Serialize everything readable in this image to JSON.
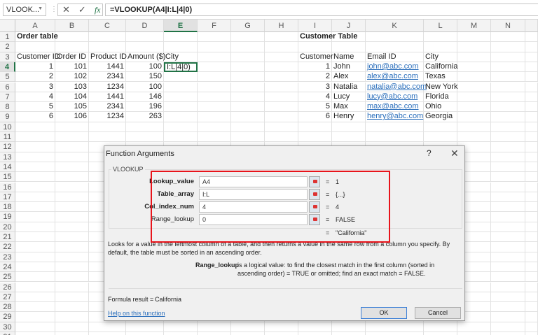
{
  "formula_bar": {
    "name_box": "VLOOK...",
    "formula": "=VLOOKUP(A4|I:L|4|0)"
  },
  "sheet": {
    "columns": [
      "A",
      "B",
      "C",
      "D",
      "E",
      "F",
      "G",
      "H",
      "I",
      "J",
      "K",
      "L",
      "M",
      "N",
      ""
    ],
    "selected_column": "E",
    "selected_row": 4,
    "active_cell": "E4",
    "row_count": 31,
    "cells": {
      "A1": "Order table",
      "I1": "Customer Table",
      "A3": "Customer ID",
      "B3": "Order ID",
      "C3": "Product ID",
      "D3": "Amount ($)",
      "E3": "City",
      "I3": "Customer",
      "J3": "Name",
      "K3": "Email ID",
      "L3": "City",
      "A4": "1",
      "B4": "101",
      "C4": "1441",
      "D4": "100",
      "E4": "I:L|4|0)",
      "I4": "1",
      "J4": "John",
      "K4": "john@abc.com",
      "L4": "California",
      "A5": "2",
      "B5": "102",
      "C5": "2341",
      "D5": "150",
      "I5": "2",
      "J5": "Alex",
      "K5": "alex@abc.com",
      "L5": "Texas",
      "A6": "3",
      "B6": "103",
      "C6": "1234",
      "D6": "100",
      "I6": "3",
      "J6": "Natalia",
      "K6": "natalia@abc.com",
      "L6": "New York",
      "A7": "4",
      "B7": "104",
      "C7": "1441",
      "D7": "146",
      "I7": "4",
      "J7": "Lucy",
      "K7": "lucy@abc.com",
      "L7": "Florida",
      "A8": "5",
      "B8": "105",
      "C8": "2341",
      "D8": "196",
      "I8": "5",
      "J8": "Max",
      "K8": "max@abc.com",
      "L8": "Ohio",
      "A9": "6",
      "B9": "106",
      "C9": "1234",
      "D9": "263",
      "I9": "6",
      "J9": "Henry",
      "K9": "henry@abc.com",
      "L9": "Georgia"
    }
  },
  "dialog": {
    "title": "Function Arguments",
    "help_glyph": "?",
    "close_glyph": "✕",
    "function_name": "VLOOKUP",
    "args": [
      {
        "label": "Lookup_value",
        "value": "A4",
        "result": "1",
        "bold": true
      },
      {
        "label": "Table_array",
        "value": "I:L",
        "result": "{...}",
        "bold": true
      },
      {
        "label": "Col_index_num",
        "value": "4",
        "result": "4",
        "bold": true
      },
      {
        "label": "Range_lookup",
        "value": "0",
        "result": "FALSE",
        "bold": false
      }
    ],
    "eq": "=",
    "overall_result": "\"California\"",
    "description": "Looks for a value in the leftmost column of a table, and then returns a value in the same row from a column you specify. By default, the table must be sorted in an ascending order.",
    "arg_help_name": "Range_lookup",
    "arg_help_text": "is a logical value: to find the closest match in the first column (sorted in ascending order) = TRUE or omitted; find an exact match = FALSE.",
    "formula_result_label": "Formula result =",
    "formula_result": "California",
    "help_link": "Help on this function",
    "ok": "OK",
    "cancel": "Cancel"
  }
}
